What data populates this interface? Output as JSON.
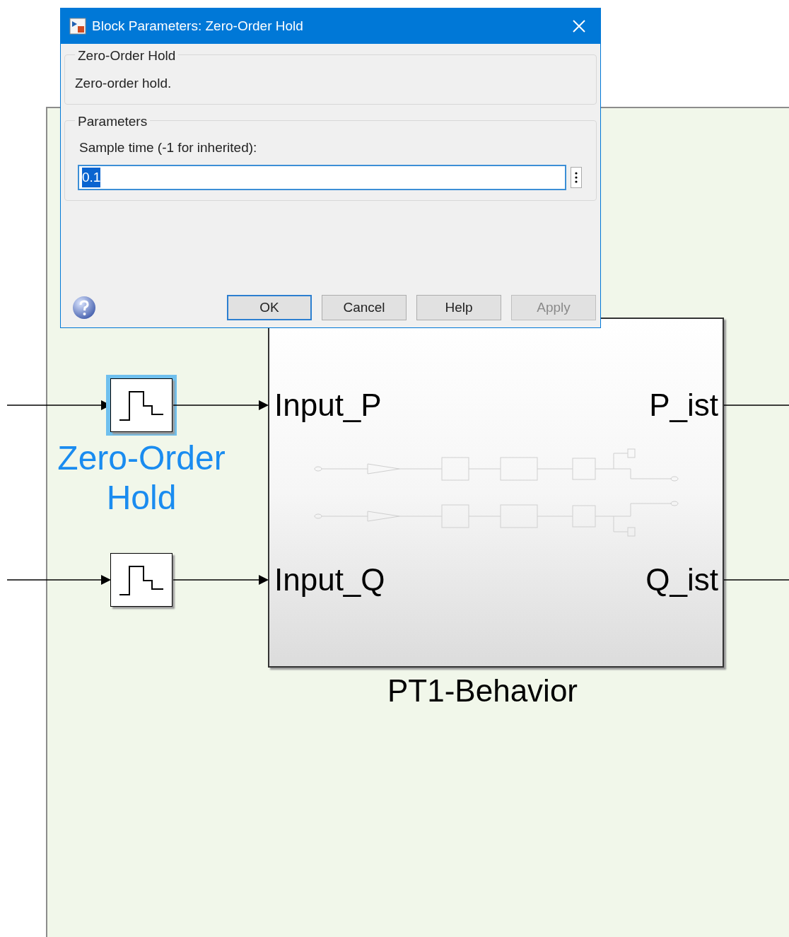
{
  "dialog": {
    "title": "Block Parameters: Zero-Order Hold",
    "block_group": {
      "title": "Zero-Order Hold",
      "description": "Zero-order hold."
    },
    "parameters_group": {
      "title": "Parameters",
      "fields": [
        {
          "label": "Sample time (-1 for inherited):",
          "value": "0.1",
          "highlighted": true
        }
      ]
    },
    "buttons": [
      {
        "label": "OK",
        "focused": true,
        "disabled": false
      },
      {
        "label": "Cancel",
        "focused": false,
        "disabled": false
      },
      {
        "label": "Help",
        "focused": false,
        "disabled": false
      },
      {
        "label": "Apply",
        "focused": false,
        "disabled": true
      }
    ]
  },
  "diagram": {
    "blocks": [
      {
        "kind": "zero-order-hold",
        "label": "Zero-Order Hold",
        "selected": true
      },
      {
        "kind": "zero-order-hold",
        "selected": false
      }
    ],
    "subsystem": {
      "title": "PT1-Behavior",
      "inputs": [
        "Input_P",
        "Input_Q"
      ],
      "outputs": [
        "P_ist",
        "Q_ist"
      ]
    }
  }
}
